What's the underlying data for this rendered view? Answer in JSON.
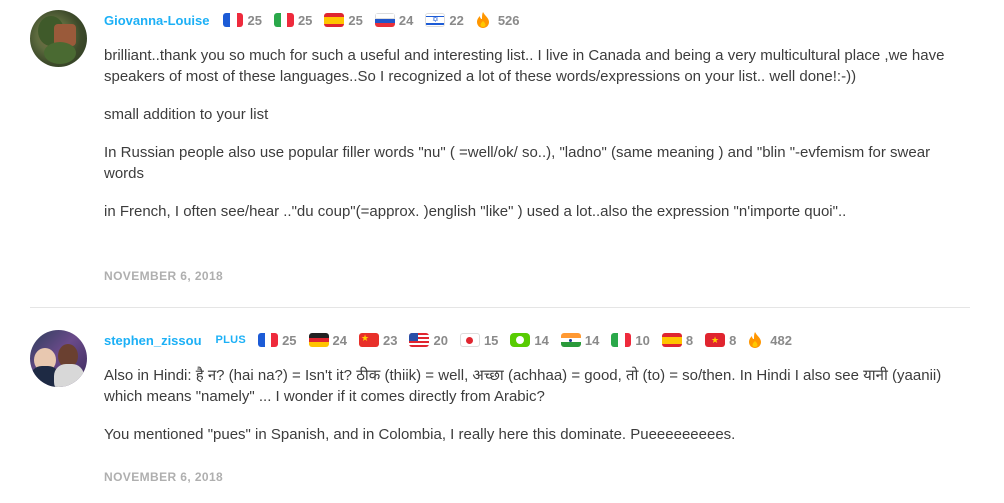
{
  "comments": [
    {
      "username": "Giovanna-Louise",
      "plus": "",
      "languages": [
        {
          "flag": "fr",
          "level": "25"
        },
        {
          "flag": "it",
          "level": "25"
        },
        {
          "flag": "es",
          "level": "25"
        },
        {
          "flag": "ru",
          "level": "24"
        },
        {
          "flag": "il",
          "level": "22"
        }
      ],
      "streak": "526",
      "paragraphs": [
        "brilliant..thank you so much for such a useful and interesting list.. I live in Canada and being a very multicultural place ,we have speakers of most of these languages..So I recognized a lot of these words/expressions on your list.. well done!:-))",
        "small addition to your list",
        "In Russian people also use popular filler words \"nu\" ( =well/ok/ so..), \"ladno\" (same meaning ) and \"blin \"-evfemism for swear words",
        "in French, I often see/hear ..\"du coup\"(=approx. )english \"like\" ) used a lot..also the expression \"n'importe quoi\".."
      ],
      "date": "NOVEMBER 6, 2018"
    },
    {
      "username": "stephen_zissou",
      "plus": "PLUS",
      "languages": [
        {
          "flag": "fr",
          "level": "25"
        },
        {
          "flag": "de",
          "level": "24"
        },
        {
          "flag": "cn",
          "level": "23"
        },
        {
          "flag": "us",
          "level": "20"
        },
        {
          "flag": "jp",
          "level": "15"
        },
        {
          "flag": "owl",
          "level": "14"
        },
        {
          "flag": "in",
          "level": "14"
        },
        {
          "flag": "it",
          "level": "10"
        },
        {
          "flag": "es",
          "level": "8"
        },
        {
          "flag": "vn",
          "level": "8"
        }
      ],
      "streak": "482",
      "paragraphs": [
        "Also in Hindi: है न? (hai na?) = Isn't it? ठीक (thiik) = well, अच्छा (achhaa) = good, तो (to) = so/then. In Hindi I also see यानी (yaanii) which means \"namely\" ... I wonder if it comes directly from Arabic?",
        "You mentioned \"pues\" in Spanish, and in Colombia, I really here this dominate. Pueeeeeeeees."
      ],
      "date": "NOVEMBER 6, 2018"
    }
  ],
  "colors": {
    "username": "#1cb0f6",
    "meta": "#afafaf",
    "text": "#3c3c3c",
    "flame": "#ff9600"
  }
}
